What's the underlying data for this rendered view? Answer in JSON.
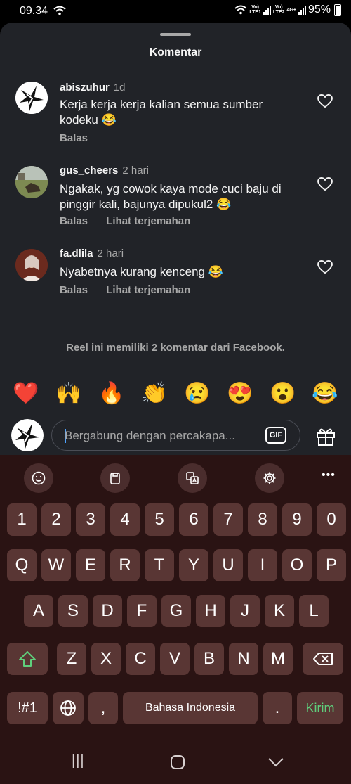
{
  "status": {
    "time": "09.34",
    "sim1_label": "Vo)\nLTE1",
    "sim2_label": "Vo)\nLTE2",
    "data_label": "4G+",
    "battery": "95%"
  },
  "sheet": {
    "title": "Komentar",
    "comments": [
      {
        "username": "abiszuhur",
        "time": "1d",
        "text": "Kerja kerja kerja kalian semua sumber kodeku 😂",
        "reply": "Balas",
        "translate": ""
      },
      {
        "username": "gus_cheers",
        "time": "2 hari",
        "text": "Ngakak, yg cowok kaya mode cuci baju di pinggir kali, bajunya dipukul2 😂",
        "reply": "Balas",
        "translate": "Lihat terjemahan"
      },
      {
        "username": "fa.dlila",
        "time": "2 hari",
        "text": "Nyabetnya kurang kenceng 😂",
        "reply": "Balas",
        "translate": "Lihat terjemahan"
      }
    ],
    "facebook_note": "Reel ini memiliki 2 komentar dari Facebook."
  },
  "reactions": [
    "❤️",
    "🙌",
    "🔥",
    "👏",
    "😢",
    "😍",
    "😮",
    "😂"
  ],
  "composer": {
    "placeholder": "Bergabung dengan percakapa...",
    "gif_label": "GIF"
  },
  "keyboard": {
    "toolbar_icons": [
      "emoji-icon",
      "clipboard-icon",
      "translate-icon",
      "settings-icon",
      "more-icon"
    ],
    "more_label": "•••",
    "row1": [
      "1",
      "2",
      "3",
      "4",
      "5",
      "6",
      "7",
      "8",
      "9",
      "0"
    ],
    "row2": [
      "Q",
      "W",
      "E",
      "R",
      "T",
      "Y",
      "U",
      "I",
      "O",
      "P"
    ],
    "row3": [
      "A",
      "S",
      "D",
      "F",
      "G",
      "H",
      "J",
      "K",
      "L"
    ],
    "row4": [
      "Z",
      "X",
      "C",
      "V",
      "B",
      "N",
      "M"
    ],
    "symbols": "!#1",
    "comma": ",",
    "space": "Bahasa Indonesia",
    "period": ".",
    "send": "Kirim",
    "shift_color": "#5fcf7c"
  },
  "navbar": {
    "recents": "|||"
  }
}
